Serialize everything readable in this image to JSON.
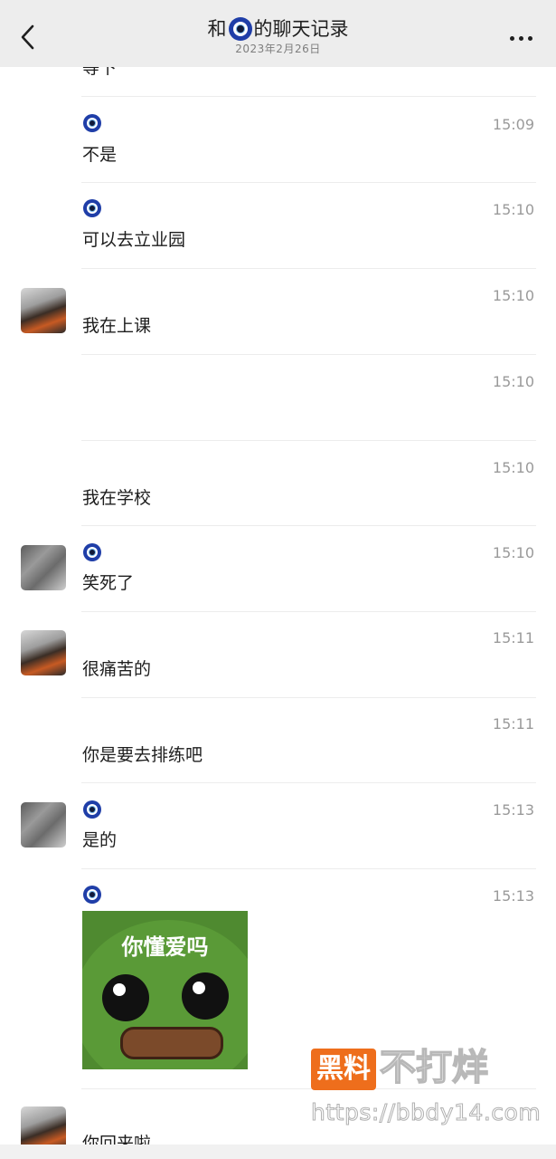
{
  "header": {
    "title_prefix": "和",
    "title_suffix": "的聊天记录",
    "date": "2023年2月26日",
    "back_icon": "chevron-left-icon",
    "more_icon": "more-dots-icon"
  },
  "messages": [
    {
      "text": "等下",
      "time": "",
      "sender": "partial"
    },
    {
      "text": "不是",
      "time": "15:09",
      "sender": "evil-eye"
    },
    {
      "text": "可以去立业园",
      "time": "15:10",
      "sender": "evil-eye"
    },
    {
      "text": "我在上课",
      "time": "15:10",
      "sender": "avatar"
    },
    {
      "text": "",
      "time": "15:10",
      "sender": "continuation"
    },
    {
      "text": "我在学校",
      "time": "15:10",
      "sender": "continuation"
    },
    {
      "text": "笑死了",
      "time": "15:10",
      "sender": "evil-eye"
    },
    {
      "text": "很痛苦的",
      "time": "15:11",
      "sender": "avatar"
    },
    {
      "text": "你是要去排练吧",
      "time": "15:11",
      "sender": "continuation"
    },
    {
      "text": "是的",
      "time": "15:13",
      "sender": "evil-eye"
    },
    {
      "text": "你懂爱吗",
      "time": "15:13",
      "sender": "evil-eye",
      "type": "sticker"
    },
    {
      "text": "你回来啦",
      "time": "",
      "sender": "avatar"
    }
  ],
  "watermark": {
    "brand_box": "黑料",
    "brand_text": "不打烊",
    "url": "https://bbdy14.com"
  },
  "colors": {
    "header_bg": "#ededed",
    "eye_blue": "#1f3ea8",
    "watermark_orange": "#ee6e1c"
  }
}
